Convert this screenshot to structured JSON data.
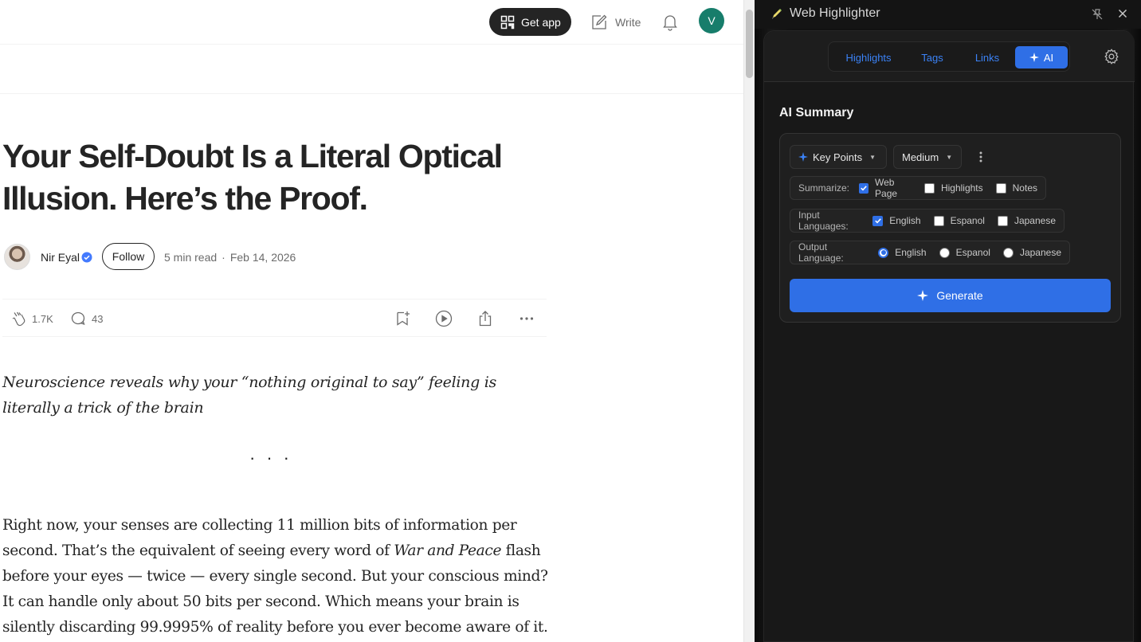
{
  "article": {
    "topbar": {
      "get_app": "Get app",
      "write": "Write",
      "avatar_letter": "V"
    },
    "title_line1": "Your Self-Doubt Is a Literal Optical",
    "title_line2": "Illusion. Here’s the Proof.",
    "author": {
      "name": "Nir Eyal",
      "follow": "Follow",
      "read_time": "5 min read",
      "dot": "·",
      "date": "Feb 14, 2026"
    },
    "stats": {
      "claps": "1.7K",
      "responses": "43"
    },
    "subtitle": "Neuroscience reveals why your “nothing original to say” feeling is literally a trick of the brain",
    "separator": "···",
    "paragraph": {
      "part1": "Right now, your senses are collecting 11 million bits of information per second. That’s the equivalent of seeing every word of ",
      "italic": "War and Peace",
      "part2": " flash before your eyes — twice — every single second. But your conscious mind? It can handle only about 50 bits per second. Which means your brain is silently discarding 99.9995% of reality before you ever become aware of it."
    }
  },
  "panel": {
    "title": "Web Highlighter",
    "tabs": [
      "Highlights",
      "Tags",
      "Links",
      "AI"
    ],
    "active_tab": "AI",
    "section_title": "AI Summary",
    "mode_dropdown": "Key Points",
    "length_dropdown": "Medium",
    "summarize": {
      "label": "Summarize:",
      "options": [
        "Web Page",
        "Highlights",
        "Notes"
      ],
      "checked": [
        true,
        false,
        false
      ]
    },
    "input_languages": {
      "label": "Input Languages:",
      "options": [
        "English",
        "Espanol",
        "Japanese"
      ],
      "checked": [
        true,
        false,
        false
      ]
    },
    "output_language": {
      "label": "Output Language:",
      "options": [
        "English",
        "Espanol",
        "Japanese"
      ],
      "selected": "English"
    },
    "generate": "Generate",
    "accent": "#2f6fe6"
  }
}
